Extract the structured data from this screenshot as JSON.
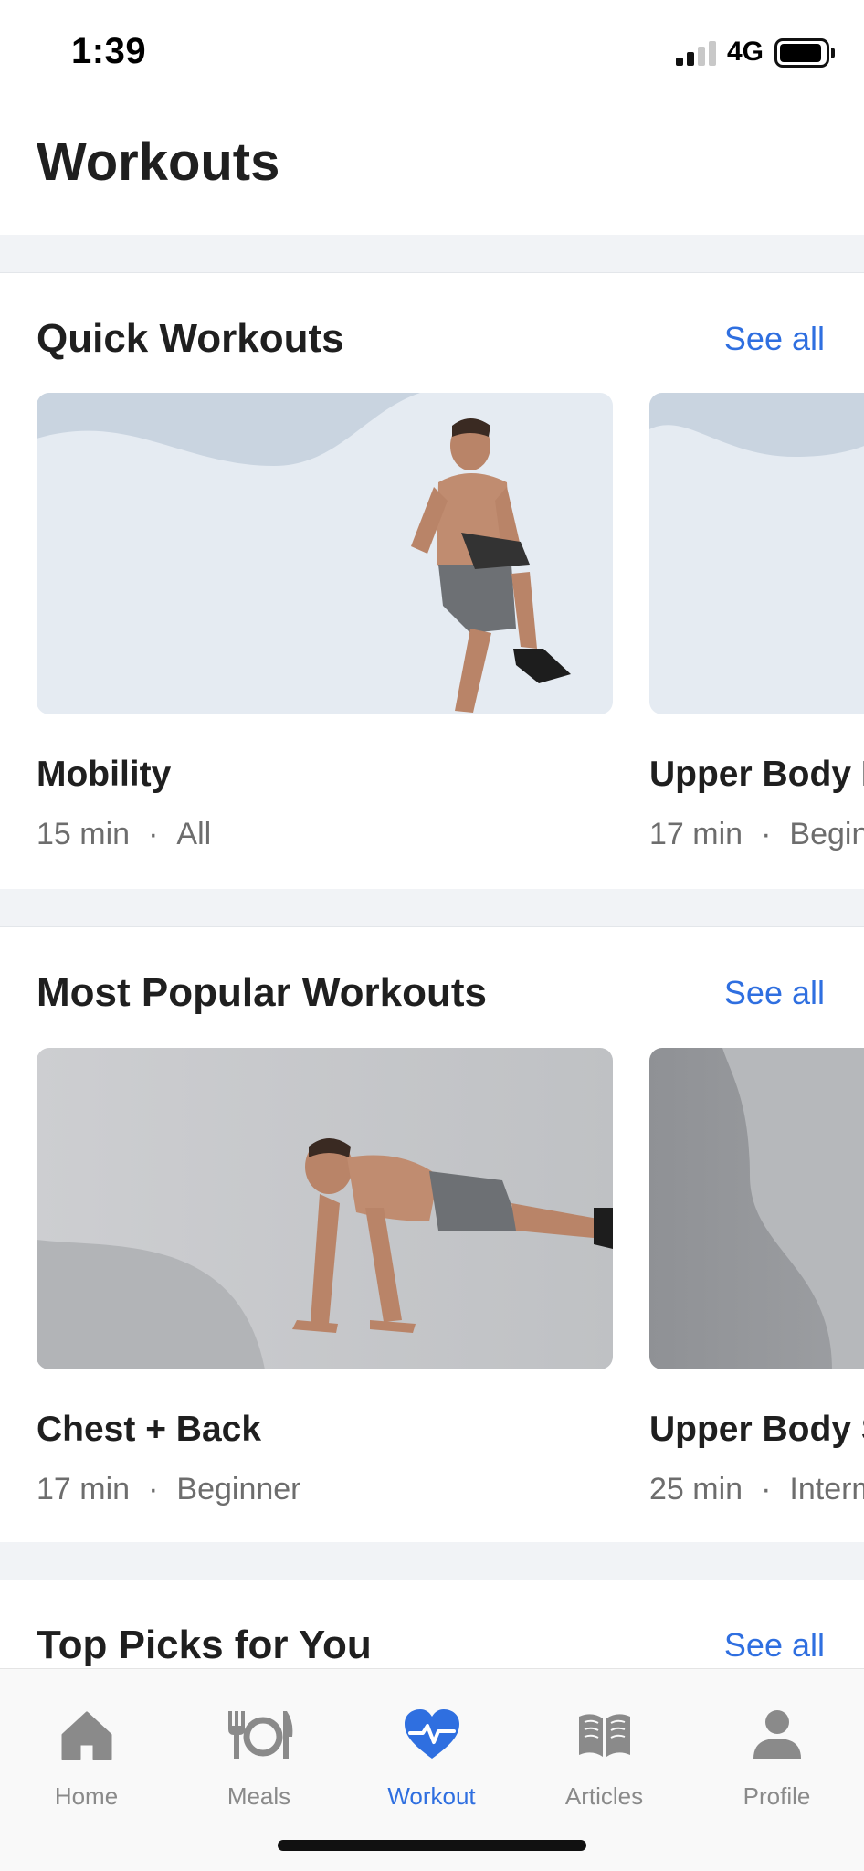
{
  "status_bar": {
    "time": "1:39",
    "network": "4G",
    "signal_bars": 2,
    "signal_total": 4
  },
  "header": {
    "title": "Workouts"
  },
  "sections": [
    {
      "title": "Quick Workouts",
      "see_all": "See all",
      "cards": [
        {
          "title": "Mobility",
          "duration": "15 min",
          "dot": "·",
          "level": "All"
        },
        {
          "title": "Upper Body B",
          "duration": "17 min",
          "dot": "·",
          "level": "Begin"
        }
      ]
    },
    {
      "title": "Most Popular Workouts",
      "see_all": "See all",
      "cards": [
        {
          "title": "Chest + Back",
          "duration": "17 min",
          "dot": "·",
          "level": "Beginner"
        },
        {
          "title": "Upper Body S",
          "duration": "25 min",
          "dot": "·",
          "level": "Interm"
        }
      ]
    },
    {
      "title": "Top Picks for You",
      "see_all": "See all"
    }
  ],
  "tab_bar": {
    "items": [
      {
        "label": "Home",
        "icon": "home-icon"
      },
      {
        "label": "Meals",
        "icon": "utensils-icon"
      },
      {
        "label": "Workout",
        "icon": "heart-pulse-icon",
        "active": true
      },
      {
        "label": "Articles",
        "icon": "book-icon"
      },
      {
        "label": "Profile",
        "icon": "person-icon"
      }
    ]
  },
  "colors": {
    "accent": "#2f6fe0",
    "text": "#1f1f1f",
    "muted": "#6d6d6d",
    "separator": "#f1f3f6"
  }
}
